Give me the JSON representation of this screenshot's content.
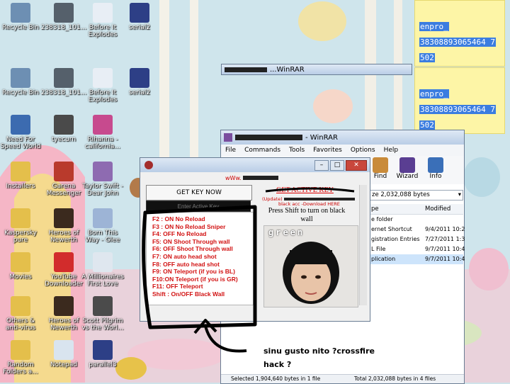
{
  "desktop": {
    "icons": [
      {
        "label": "Recycle Bin",
        "icon": "recycle-bin-icon",
        "color": "#6d8fb3"
      },
      {
        "label": "238318_101...",
        "icon": "photo-icon",
        "color": "#55606b"
      },
      {
        "label": "Before It\nExplodes",
        "icon": "mp4-file-icon",
        "color": "#e8eef5"
      },
      {
        "label": "serial2",
        "icon": "cpp-file-icon",
        "color": "#2d3f86"
      },
      {
        "label": "Recycle Bin",
        "icon": "recycle-bin-icon",
        "color": "#6d8fb3"
      },
      {
        "label": "238318_101...",
        "icon": "photo-icon",
        "color": "#55606b"
      },
      {
        "label": "Before It\nExplodes",
        "icon": "mp3-file-icon",
        "color": "#e8eef5"
      },
      {
        "label": "serial2",
        "icon": "cpp-file-icon",
        "color": "#2d3f86"
      },
      {
        "label": "Need For\nSpeed World",
        "icon": "game-icon",
        "color": "#3c6bb0"
      },
      {
        "label": "tyecurn",
        "icon": "photo-icon",
        "color": "#4a4a4a"
      },
      {
        "label": "Rihanna -\ncalifornia...",
        "icon": "music-icon",
        "color": "#c74a8e"
      },
      {
        "label": "Installers",
        "icon": "folder-icon",
        "color": "#e4bf4b"
      },
      {
        "label": "Garena\nMessenger",
        "icon": "garena-icon",
        "color": "#b93a2c"
      },
      {
        "label": "Taylor Swift -\nDear John",
        "icon": "music-icon",
        "color": "#8e6bb1"
      },
      {
        "label": "Kaspersky\npure",
        "icon": "folder-icon",
        "color": "#e4bf4b"
      },
      {
        "label": "Heroes of\nNewerth",
        "icon": "hon-icon",
        "color": "#3b2a1e"
      },
      {
        "label": "Born This\nWay - Glee",
        "icon": "music-icon",
        "color": "#9db4d6"
      },
      {
        "label": "Movies",
        "icon": "folder-icon",
        "color": "#e4bf4b"
      },
      {
        "label": "YouTube\nDownloader",
        "icon": "youtube-icon",
        "color": "#d22c2c"
      },
      {
        "label": "A Millionaires\nFirst Love",
        "icon": "video-icon",
        "color": "#dfe7ef"
      },
      {
        "label": "Others &\nanti-virus",
        "icon": "folder-icon",
        "color": "#e4bf4b"
      },
      {
        "label": "Heroes of\nNewerth",
        "icon": "hon-icon",
        "color": "#3b2a1e"
      },
      {
        "label": "Scott Pilgrim\nvs the Worl...",
        "icon": "film-icon",
        "color": "#4b4b4b"
      },
      {
        "label": "Random\nFolders a...",
        "icon": "folder-icon",
        "color": "#e4bf4b"
      },
      {
        "label": "Notepad",
        "icon": "notepad-icon",
        "color": "#d9e4ef"
      },
      {
        "label": "parallel3",
        "icon": "cpp-file-icon",
        "color": "#2d3f86"
      }
    ]
  },
  "sticky_notes": [
    {
      "lines": [
        "enpro_",
        "38308893065464 7",
        "502"
      ]
    },
    {
      "lines": [
        "enpro_",
        "38308893065464 7",
        "502"
      ]
    }
  ],
  "winrar_back": {
    "title_suffix": "...WinRAR"
  },
  "winrar": {
    "title_suffix": "- WinRAR",
    "menu": [
      "File",
      "Commands",
      "Tools",
      "Favorites",
      "Options",
      "Help"
    ],
    "tools": [
      {
        "label": "Find",
        "icon": "find-icon"
      },
      {
        "label": "Wizard",
        "icon": "wizard-icon"
      },
      {
        "label": "Info",
        "icon": "info-icon"
      }
    ],
    "size_text": "ze 2,032,088 bytes",
    "columns": [
      "pe",
      "Modified"
    ],
    "rows": [
      {
        "type": "e folder",
        "modified": ""
      },
      {
        "type": "ernet Shortcut",
        "modified": "9/4/2011 10:2"
      },
      {
        "type": "gistration Entries",
        "modified": "7/27/2011 1:3"
      },
      {
        "type": "L File",
        "modified": "9/7/2011 10:4"
      },
      {
        "type": "plication",
        "modified": "9/7/2011 10:4"
      }
    ],
    "status_left": "Selected 1,904,640 bytes in 1 file",
    "status_right": "Total 2,032,088 bytes in 4 files"
  },
  "hack_window": {
    "site": "wWw.",
    "get_key_button": "GET KEY NOW",
    "key_placeholder": "Enter Active Key",
    "cheats": [
      "F2 : ON No Reload",
      "F3 : ON No Reload Sniper",
      "F4: OFF No Reload",
      "F5: ON Shoot Through wall",
      "F6: OFF  Shoot Through wall",
      "F7: ON  auto head shot",
      "F8: OFF  auto head shot",
      "F9: ON Teleport (if you is BL)",
      "F10:ON Teleport (if you is GR)",
      "F11: OFF Teleport",
      "Shift : On/OFF Black Wall"
    ],
    "get_active_key_link": "GET ACTIVE KEY",
    "update_line": "(Update)",
    "download_line": "black acc -Download HERE",
    "shift_text": "Press Shift to turn on black wall",
    "photo_caption": "green"
  },
  "annotation": {
    "line1": "sinu gusto nito ?crossfire",
    "line2": "hack ?"
  }
}
